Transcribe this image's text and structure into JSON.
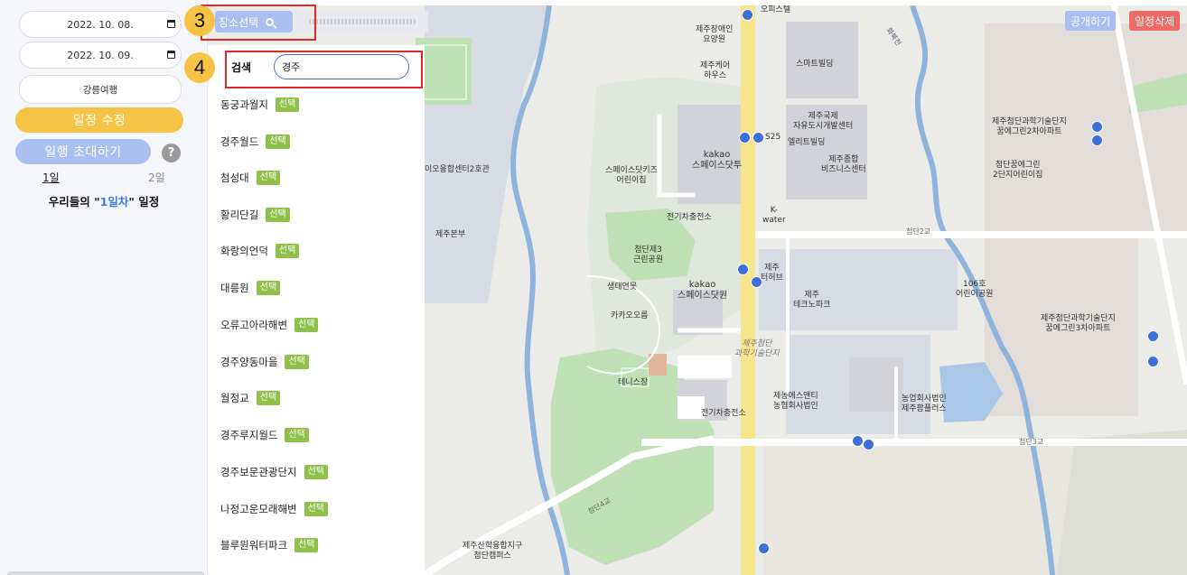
{
  "sidebar": {
    "start_date": "2022. 10. 08.",
    "end_date": "2022. 10. 09.",
    "trip_name": "강릉여행",
    "edit_label": "일정 수정",
    "invite_label": "일행 초대하기",
    "help_label": "?",
    "day_tabs": [
      "1일",
      "2일"
    ],
    "schedule_prefix": "우리들의 \"",
    "schedule_day": "1일차",
    "schedule_suffix": "\" 일정"
  },
  "toolbar": {
    "place_select_label": "장소선택",
    "search_label": "검색",
    "search_value": "경주"
  },
  "annotations": {
    "step3": "3",
    "step4": "4"
  },
  "results": {
    "select_label": "선택",
    "items": [
      "동궁과월지",
      "경주월드",
      "첨성대",
      "황리단길",
      "화랑의언덕",
      "대릉원",
      "오류고아라해변",
      "경주양동마을",
      "월정교",
      "경주루지월드",
      "경주보문관광단지",
      "나정고운모래해변",
      "블루원워터파크"
    ]
  },
  "header_buttons": {
    "publish": "공개하기",
    "delete": "일정삭제"
  },
  "map_labels": {
    "office_tower": "오피스텔",
    "jeju_disabled": "제주장애인\n요양원",
    "jeju_care": "제주케어\n하우스",
    "smart_building": "스마트빌딩",
    "intl_center": "제주국제\n자유도시개발센터",
    "elite_building": "엘리트빌딩",
    "jeju_biz": "제주종합\n비즈니스센터",
    "kakao_space": "kakao\n스페이스닷투",
    "kids_daycare": "스페이스닷키즈\n어린이집",
    "ev_station": "전기차충전소",
    "kwater": "K-\nwater",
    "cheomdan_park": "첨단제3\n근린공원",
    "eco_pond": "생태연못",
    "kakao_ol": "카카오오름",
    "kakao_space1": "kakao\n스페이스닷원",
    "jeju_terhub": "제주\n터허브",
    "jeju_techno": "제주\n테크노파크",
    "cheomdan_district": "제주첨단\n과학기술단지",
    "tennis": "테니스장",
    "ev_station2": "전기차충전소",
    "nonghyup_center": "제농에스앤티\n농협회사법인",
    "nonghyup_plaza": "농업회사법인\n제주팜플러스",
    "convergence": "이오융합센터2호관",
    "jeju_branch": "제주본부",
    "apt_north": "제주첨단과학기술단지\n꿈에그린2차아파트",
    "kindergarten": "첨단꿈에그린\n2단지어린이집",
    "kinder106": "106호\n어린이공원",
    "apt_south": "제주첨단과학기술단지\n꿈에그린3차아파트",
    "campus": "제주산학융합지구\n첨단캠퍼스",
    "bus_s25": "S25",
    "road_cd2": "첨단2교",
    "road_cd3": "첨단3교",
    "road_cd4": "첨단4교",
    "road_wd": "화북천"
  },
  "colors": {
    "accent_yellow": "#f6c444",
    "accent_blue": "#a9bff0",
    "select_green": "#8fc14a",
    "delete_red": "#ee6a66",
    "annotation_red": "#e02828"
  }
}
